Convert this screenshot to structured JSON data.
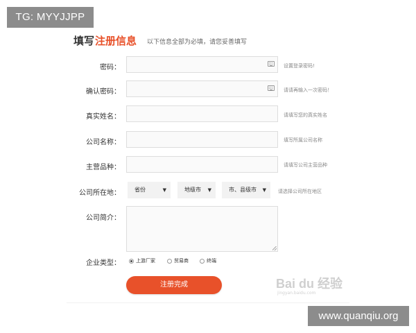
{
  "overlay": {
    "tag": "TG: MYYJJPP",
    "watermark": "www.quanqiu.org"
  },
  "header": {
    "title_prefix": "填写",
    "title_accent": "注册信息",
    "hint": "以下信息全部为必填，请您妥善填写"
  },
  "fields": {
    "password": {
      "label": "密码：",
      "hint": "设置登录密码!"
    },
    "confirm_password": {
      "label": "确认密码：",
      "hint": "请请再输入一次密码！"
    },
    "real_name": {
      "label": "真实姓名：",
      "hint": "请填写您的真实姓名"
    },
    "company_name": {
      "label": "公司名称：",
      "hint": "填写所属公司名称"
    },
    "main_products": {
      "label": "主营品种：",
      "hint": "请填写公司主营品种"
    }
  },
  "location": {
    "label": "公司所在地：",
    "province": "省份",
    "city": "地级市",
    "county": "市、县级市",
    "arrow": "▼",
    "hint": "请选择公司所在地区"
  },
  "intro": {
    "label": "公司简介："
  },
  "company_type": {
    "label": "企业类型：",
    "options": [
      {
        "label": "上游厂家",
        "checked": true
      },
      {
        "label": "贸易商",
        "checked": false
      },
      {
        "label": "终端",
        "checked": false
      }
    ]
  },
  "submit": {
    "label": "注册完成"
  },
  "colors": {
    "accent": "#e8512a",
    "text": "#333333",
    "hint_text": "#888888",
    "field_bg": "#fafafa",
    "field_border": "#dddddd",
    "select_bg": "#f2f2f2"
  },
  "baidu_watermark": {
    "logo": "Bai du 经验",
    "url": "jingyan.baidu.com"
  }
}
